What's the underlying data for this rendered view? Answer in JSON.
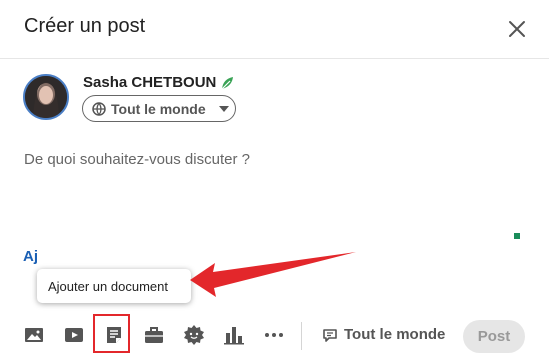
{
  "header": {
    "title": "Créer un post"
  },
  "author": {
    "name": "Sasha CHETBOUN",
    "audience": "Tout le monde"
  },
  "composer": {
    "placeholder": "De quoi souhaitez-vous discuter ?",
    "partial_link": "Aj"
  },
  "tooltip": {
    "text": "Ajouter un document"
  },
  "toolbar": {
    "icons": [
      "image-icon",
      "video-icon",
      "document-icon",
      "briefcase-icon",
      "badge-icon",
      "chart-icon",
      "more-icon"
    ],
    "visibility_label": "Tout le monde",
    "post_label": "Post"
  },
  "colors": {
    "highlight": "#e3272b",
    "link": "#1a5fb4",
    "disabled_button": "#e6e6e6"
  }
}
